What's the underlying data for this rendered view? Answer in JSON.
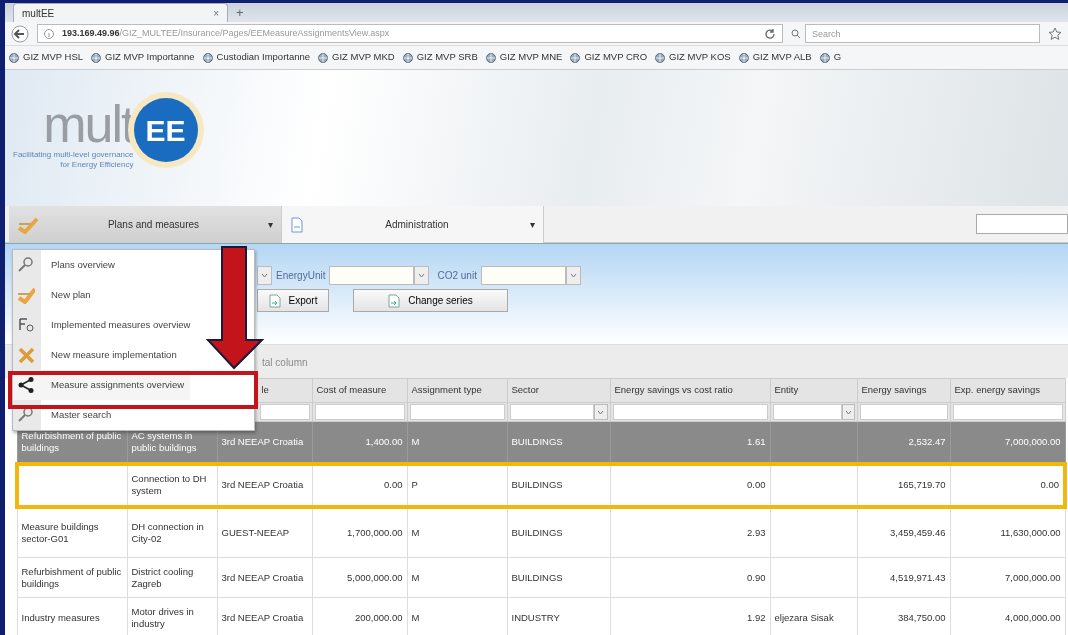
{
  "browser": {
    "tab": {
      "title": "multEE",
      "close": "×"
    },
    "new_tab": "+",
    "address": {
      "host": "193.169.49.96",
      "path": "/GIZ_MULTEE/Insurance/Pages/EEMeasureAssignmentsView.aspx"
    },
    "search": {
      "placeholder": "Search"
    },
    "bookmarks": [
      "GIZ MVP HSL",
      "GIZ MVP Importanne",
      "Custodian Importanne",
      "GIZ MVP MKD",
      "GIZ MVP SRB",
      "GIZ MVP MNE",
      "GIZ MVP CRO",
      "GIZ MVP KOS",
      "GIZ MVP ALB",
      "G"
    ]
  },
  "header": {
    "logo": {
      "word": "mult",
      "badge": "EE",
      "tagline": [
        "Facilitating multi-level governance",
        "for Energy Efficiency"
      ]
    }
  },
  "menubar": {
    "items": [
      {
        "label": "Plans and measures",
        "caret": "▾",
        "open": true
      },
      {
        "label": "Administration",
        "caret": "▾",
        "open": false
      }
    ]
  },
  "menu": {
    "items": [
      {
        "label": "Plans overview",
        "highlighted": false
      },
      {
        "label": "New plan",
        "highlighted": false
      },
      {
        "label": "Implemented measures overview",
        "highlighted": false
      },
      {
        "label": "New measure implementation",
        "highlighted": false
      },
      {
        "label": "Measure assignments overview",
        "highlighted": true
      },
      {
        "label": "Master search",
        "highlighted": false
      }
    ]
  },
  "filters": {
    "energy_unit_label": "EnergyUnit",
    "co2_unit_label": "CO2 unit",
    "buttons": [
      "Export",
      "Change series"
    ]
  },
  "group_panel": {
    "hint": "tal column"
  },
  "table": {
    "columns": [
      {},
      {},
      {
        "label": "le"
      },
      {
        "label": "Cost of measure"
      },
      {
        "label": "Assignment type"
      },
      {
        "label": "Sector"
      },
      {
        "label": "Energy savings vs cost ratio"
      },
      {
        "label": "Entity"
      },
      {
        "label": "Energy savings"
      },
      {
        "label": "Exp. energy savings"
      }
    ],
    "rows": [
      {
        "selected": true,
        "highlighted": false,
        "cells": [
          "Refurbishment of public buildings",
          "AC systems in public buildings",
          "3rd NEEAP Croatia",
          "1,400.00",
          "M",
          "BUILDINGS",
          "1.61",
          null,
          "2,532.47",
          "7,000,000.00"
        ]
      },
      {
        "selected": false,
        "highlighted": true,
        "cells": [
          null,
          "Connection to DH system",
          "3rd NEEAP Croatia",
          "0.00",
          "P",
          "BUILDINGS",
          "0.00",
          null,
          "165,719.70",
          "0.00"
        ]
      },
      {
        "selected": false,
        "highlighted": false,
        "cells": [
          "Measure buildings sector-G01",
          "DH connection in City-02",
          "GUEST-NEEAP",
          "1,700,000.00",
          "M",
          "BUILDINGS",
          "2.93",
          null,
          "3,459,459.46",
          "11,630,000.00"
        ]
      },
      {
        "selected": false,
        "highlighted": false,
        "cells": [
          "Refurbishment of public buildings",
          "District cooling Zagreb",
          "3rd NEEAP Croatia",
          "5,000,000.00",
          "M",
          "BUILDINGS",
          "0.90",
          null,
          "4,519,971.43",
          "7,000,000.00"
        ]
      },
      {
        "selected": false,
        "highlighted": false,
        "cells": [
          "Industry measures",
          "Motor drives in industry",
          "3rd NEEAP Croatia",
          "200,000.00",
          "M",
          "INDUSTRY",
          "1.92",
          "eljezara Sisak",
          "384,750.00",
          "4,000,000.00"
        ]
      }
    ]
  }
}
